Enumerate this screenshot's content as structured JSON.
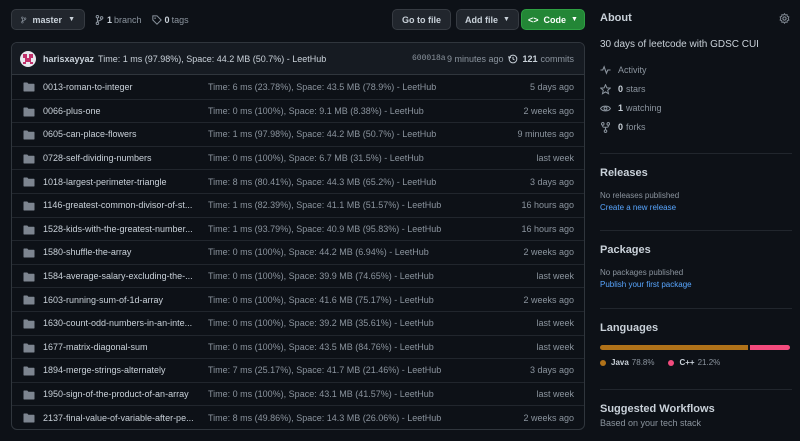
{
  "toolbar": {
    "branch": "master",
    "branch_count": "1",
    "branch_label": "branch",
    "tag_count": "0",
    "tag_label": "tags",
    "goto": "Go to file",
    "add": "Add file",
    "code": "Code"
  },
  "commit": {
    "author": "harisxayyaz",
    "message": "Time: 1 ms (97.98%), Space: 44.2 MB (50.7%) - LeetHub",
    "hash": "600018a",
    "time": "9 minutes ago",
    "count": "121",
    "count_label": "commits"
  },
  "files": [
    {
      "name": "0013-roman-to-integer",
      "msg": "Time: 6 ms (23.78%), Space: 43.5 MB (78.9%) - LeetHub",
      "time": "5 days ago"
    },
    {
      "name": "0066-plus-one",
      "msg": "Time: 0 ms (100%), Space: 9.1 MB (8.38%) - LeetHub",
      "time": "2 weeks ago"
    },
    {
      "name": "0605-can-place-flowers",
      "msg": "Time: 1 ms (97.98%), Space: 44.2 MB (50.7%) - LeetHub",
      "time": "9 minutes ago"
    },
    {
      "name": "0728-self-dividing-numbers",
      "msg": "Time: 0 ms (100%), Space: 6.7 MB (31.5%) - LeetHub",
      "time": "last week"
    },
    {
      "name": "1018-largest-perimeter-triangle",
      "msg": "Time: 8 ms (80.41%), Space: 44.3 MB (65.2%) - LeetHub",
      "time": "3 days ago"
    },
    {
      "name": "1146-greatest-common-divisor-of-st...",
      "msg": "Time: 1 ms (82.39%), Space: 41.1 MB (51.57%) - LeetHub",
      "time": "16 hours ago"
    },
    {
      "name": "1528-kids-with-the-greatest-number...",
      "msg": "Time: 1 ms (93.79%), Space: 40.9 MB (95.83%) - LeetHub",
      "time": "16 hours ago"
    },
    {
      "name": "1580-shuffle-the-array",
      "msg": "Time: 0 ms (100%), Space: 44.2 MB (6.94%) - LeetHub",
      "time": "2 weeks ago"
    },
    {
      "name": "1584-average-salary-excluding-the-...",
      "msg": "Time: 0 ms (100%), Space: 39.9 MB (74.65%) - LeetHub",
      "time": "last week"
    },
    {
      "name": "1603-running-sum-of-1d-array",
      "msg": "Time: 0 ms (100%), Space: 41.6 MB (75.17%) - LeetHub",
      "time": "2 weeks ago"
    },
    {
      "name": "1630-count-odd-numbers-in-an-inte...",
      "msg": "Time: 0 ms (100%), Space: 39.2 MB (35.61%) - LeetHub",
      "time": "last week"
    },
    {
      "name": "1677-matrix-diagonal-sum",
      "msg": "Time: 0 ms (100%), Space: 43.5 MB (84.76%) - LeetHub",
      "time": "last week"
    },
    {
      "name": "1894-merge-strings-alternately",
      "msg": "Time: 7 ms (25.17%), Space: 41.7 MB (21.46%) - LeetHub",
      "time": "3 days ago"
    },
    {
      "name": "1950-sign-of-the-product-of-an-array",
      "msg": "Time: 0 ms (100%), Space: 43.1 MB (41.57%) - LeetHub",
      "time": "last week"
    },
    {
      "name": "2137-final-value-of-variable-after-pe...",
      "msg": "Time: 8 ms (49.86%), Space: 14.3 MB (26.06%) - LeetHub",
      "time": "2 weeks ago"
    }
  ],
  "about": {
    "title": "About",
    "description": "30 days of leetcode with GDSC CUI",
    "activity": "Activity",
    "stars_count": "0",
    "stars_label": "stars",
    "watching_count": "1",
    "watching_label": "watching",
    "forks_count": "0",
    "forks_label": "forks"
  },
  "releases": {
    "title": "Releases",
    "none": "No releases published",
    "link": "Create a new release"
  },
  "packages": {
    "title": "Packages",
    "none": "No packages published",
    "link": "Publish your first package"
  },
  "languages": {
    "title": "Languages",
    "items": [
      {
        "name": "Java",
        "pct": "78.8%",
        "share": 78.8,
        "color": "#b07219"
      },
      {
        "name": "C++",
        "pct": "21.2%",
        "share": 21.2,
        "color": "#f34b7d"
      }
    ]
  },
  "workflows": {
    "title": "Suggested Workflows",
    "subtitle": "Based on your tech stack"
  }
}
